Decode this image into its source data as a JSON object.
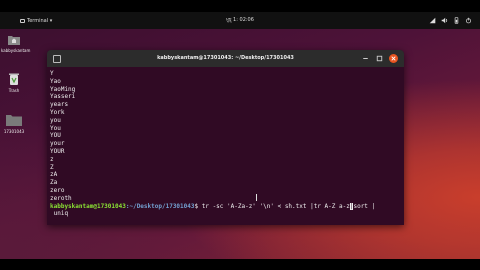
{
  "topbar": {
    "app_label": "Terminal ▾",
    "clock": "মুহূ 1: 02:06",
    "tray_icons": [
      "network-icon",
      "volume-icon",
      "battery-icon",
      "power-menu-icon"
    ]
  },
  "desktop": {
    "icons": [
      {
        "label": "kabbyskantam",
        "icon": "home-folder-icon"
      },
      {
        "label": "Trash",
        "icon": "trash-icon"
      },
      {
        "label": "17301043",
        "icon": "folder-icon"
      }
    ]
  },
  "window": {
    "title": "kabbyskantam@17301043: ~/Desktop/17301043",
    "close_color": "#e95420"
  },
  "terminal": {
    "lines": [
      "Y",
      "Yao",
      "YaoMing",
      "Yasseri",
      "years",
      "York",
      "you",
      "You",
      "YOU",
      "your",
      "YOUR",
      "z",
      "Z",
      "zA",
      "Za",
      "zero",
      "zeroth"
    ],
    "prompt_user": "kabbyskantam@17301043",
    "prompt_path": ":~/Desktop/17301043",
    "prompt_sign": "$ ",
    "command_before_cursor": "tr -sc 'A-Za-z' '\\n' < sh.txt |tr A-Z a-z",
    "cursor_char": "|",
    "command_after_cursor": "sort |",
    "command_wrap": " uniq"
  },
  "colors": {
    "terminal_bg": "#300a24",
    "prompt_user": "#8ae234",
    "prompt_path": "#729fcf",
    "accent": "#e95420"
  }
}
